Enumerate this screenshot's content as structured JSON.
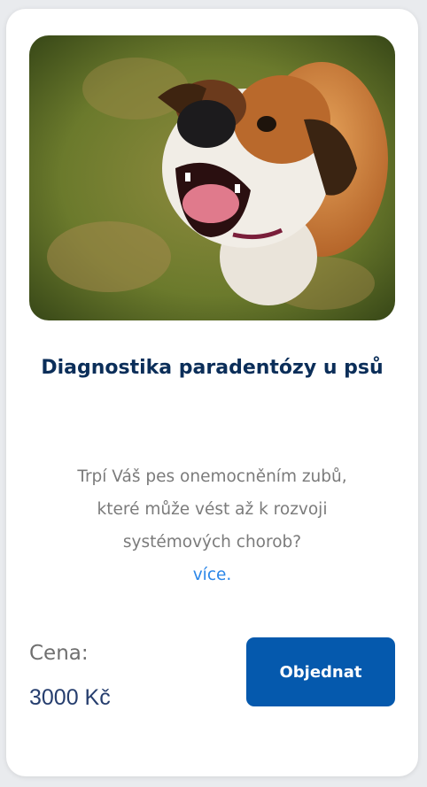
{
  "card": {
    "image": {
      "subject": "dog-photo"
    },
    "title": "Diagnostika paradentózy u psů",
    "description": "Trpí Váš pes onemocněním zubů, které může vést až k rozvoji systémových chorob?",
    "more_link": "více.",
    "price_label": "Cena:",
    "price_value": "3000 Kč",
    "order_button": "Objednat"
  },
  "colors": {
    "title": "#0b2e59",
    "link": "#2a86e8",
    "button": "#0559ad",
    "price": "#263e6e"
  }
}
